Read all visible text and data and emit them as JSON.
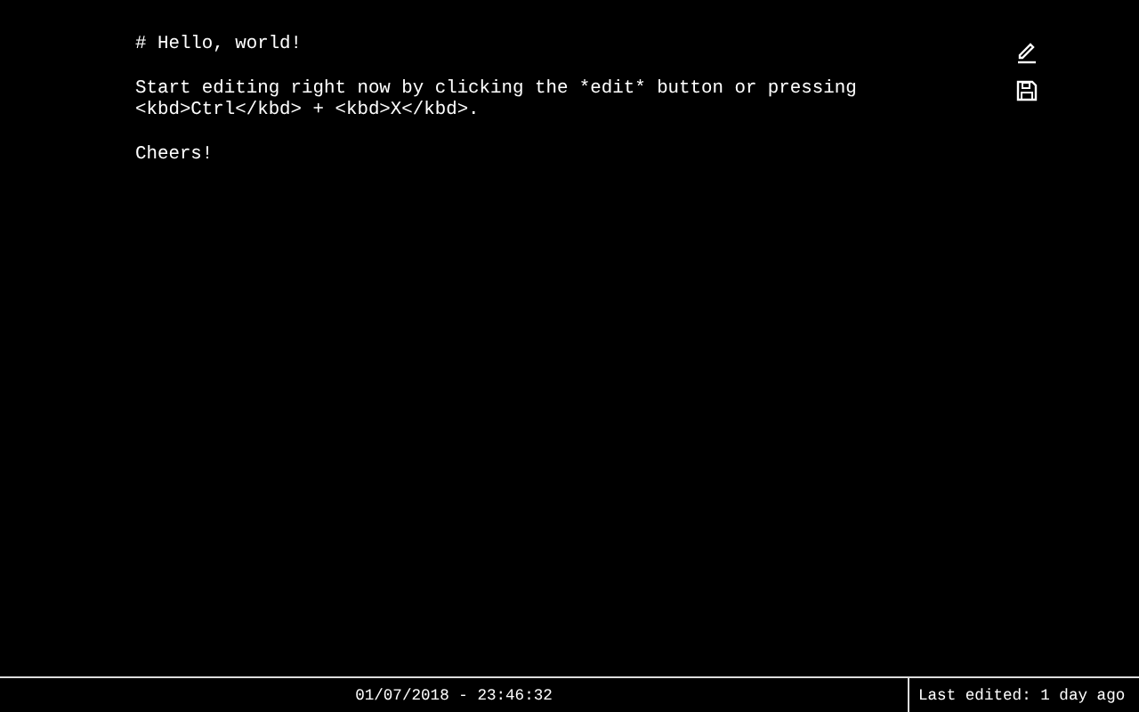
{
  "editor": {
    "paragraphs": [
      [
        "# Hello, world!"
      ],
      [
        "Start editing right now by clicking the *edit* button or pressing",
        "<kbd>Ctrl</kbd> + <kbd>X</kbd>."
      ],
      [
        "Cheers!"
      ]
    ]
  },
  "toolbar": [
    {
      "kind": "edit"
    },
    {
      "kind": "save"
    }
  ],
  "status_bar": {
    "datetime": "01/07/2018 - 23:46:32",
    "last_edited": "Last edited: 1 day ago"
  }
}
